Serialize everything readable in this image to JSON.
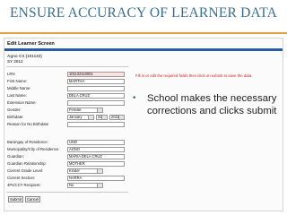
{
  "slide": {
    "title": "ENSURE ACCURACY OF LEARNER DATA"
  },
  "screen": {
    "title": "Edit Learner Screen",
    "school_name": "Agno CS (101132)",
    "school_year": "SY 2012",
    "instruction": "Fill in or edit the required fields then click on submit to save the data.",
    "fields": [
      {
        "label": "LRN",
        "value": "101132110001"
      },
      {
        "label": "First Name:",
        "value": "MARTHA"
      },
      {
        "label": "Middle Name:",
        "value": ""
      },
      {
        "label": "Last Name:",
        "value": "DELA CRUZ"
      },
      {
        "label": "Extension Name:",
        "value": ""
      },
      {
        "label": "Gender:",
        "value": "Female"
      },
      {
        "label": "Birthdate:",
        "month": "January",
        "day": "31",
        "year": "2011"
      },
      {
        "label": "Reason for No Birthdate",
        "value": ""
      },
      {
        "label": "Barangay of Residence:",
        "value": "UNO"
      },
      {
        "label": "Municipality/City of Residence:",
        "value": "AGNO"
      },
      {
        "label": "Guardian:",
        "value": "MARIA DELA CRUZ"
      },
      {
        "label": "Guardian Relationship:",
        "value": "MOTHER"
      },
      {
        "label": "Current Grade Level:",
        "value": "Kinder"
      },
      {
        "label": "Current Section:",
        "value": "NARRA"
      },
      {
        "label": "4Ps/CCT Recipient:",
        "value": "No"
      }
    ],
    "buttons": {
      "submit": "Submit",
      "cancel": "Cancel"
    }
  },
  "bullet": {
    "text": "School makes the necessary corrections and clicks submit"
  }
}
